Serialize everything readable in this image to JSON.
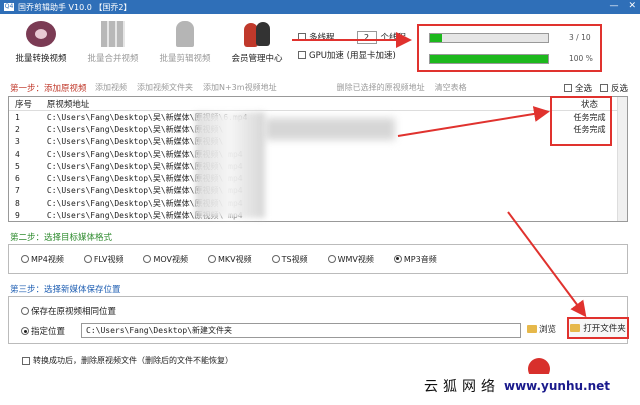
{
  "window": {
    "title": "国乔剪辑助手 V10.0  【国乔2】",
    "app_icon_label": "Q4",
    "minimize": "—",
    "close": "✕"
  },
  "toolbar": {
    "tools": [
      {
        "label": "批量转换视频",
        "icon": "film-reel-icon",
        "disabled": false
      },
      {
        "label": "批量合并视频",
        "icon": "grid-icon",
        "disabled": true
      },
      {
        "label": "批量剪辑视频",
        "icon": "horse-icon",
        "disabled": true
      },
      {
        "label": "会员管理中心",
        "icon": "people-icon",
        "disabled": false
      }
    ],
    "multithread_label": "多线程",
    "thread_count": "2",
    "thread_unit": "个线程",
    "gpu_label": "GPU加速 (用显卡加速)"
  },
  "progress": {
    "bar1": {
      "fraction": 0.1,
      "text": "3 / 10"
    },
    "bar2": {
      "fraction": 1.0,
      "text": "100 %"
    }
  },
  "step1": {
    "label": "第一步：添加原视频",
    "actions": [
      "添加视频",
      "添加视频文件夹",
      "添加N+3m视频地址",
      "删除已选择的原视频地址",
      "清空表格"
    ],
    "select_all": "全选",
    "invert": "反选"
  },
  "table": {
    "headers": {
      "no": "序号",
      "path": "原视频地址",
      "status": "状态"
    },
    "rows": [
      {
        "no": "1",
        "path": "C:\\Users\\Fang\\Desktop\\吴\\新媒体\\原视频\\6.mp4",
        "status": "任务完成"
      },
      {
        "no": "2",
        "path": "C:\\Users\\Fang\\Desktop\\吴\\新媒体\\原视频\\",
        "status": "任务完成"
      },
      {
        "no": "3",
        "path": "C:\\Users\\Fang\\Desktop\\吴\\新媒体\\原视频\\",
        "status": ""
      },
      {
        "no": "4",
        "path": "C:\\Users\\Fang\\Desktop\\吴\\新媒体\\原视频\\          mp4",
        "status": ""
      },
      {
        "no": "5",
        "path": "C:\\Users\\Fang\\Desktop\\吴\\新媒体\\原视频\\          mp4",
        "status": ""
      },
      {
        "no": "6",
        "path": "C:\\Users\\Fang\\Desktop\\吴\\新媒体\\原视频\\          mp4",
        "status": ""
      },
      {
        "no": "7",
        "path": "C:\\Users\\Fang\\Desktop\\吴\\新媒体\\原视频\\          mp4",
        "status": ""
      },
      {
        "no": "8",
        "path": "C:\\Users\\Fang\\Desktop\\吴\\新媒体\\原视频\\          mp4",
        "status": ""
      },
      {
        "no": "9",
        "path": "C:\\Users\\Fang\\Desktop\\吴\\新媒体\\原视频\\          mp4",
        "status": ""
      }
    ]
  },
  "step2": {
    "label": "第二步：选择目标媒体格式",
    "formats": [
      "MP4视频",
      "FLV视频",
      "MOV视频",
      "MKV视频",
      "TS视频",
      "WMV视频",
      "MP3音频"
    ],
    "selected": "MP3音频"
  },
  "step3": {
    "label": "第三步：选择新媒体保存位置",
    "same_location": "保存在原视频相同位置",
    "custom_location": "指定位置",
    "path": "C:\\Users\\Fang\\Desktop\\新建文件夹",
    "browse": "浏览",
    "open_folder": "打开文件夹"
  },
  "delete_option": "转换成功后，删除原视频文件（删除后的文件不能恢复）",
  "watermark": {
    "text": "云狐网络",
    "url": "www.yunhu.net"
  },
  "colors": {
    "titlebar": "#2f6fb8",
    "highlight": "#e0322e",
    "progress": "#1db81d"
  }
}
